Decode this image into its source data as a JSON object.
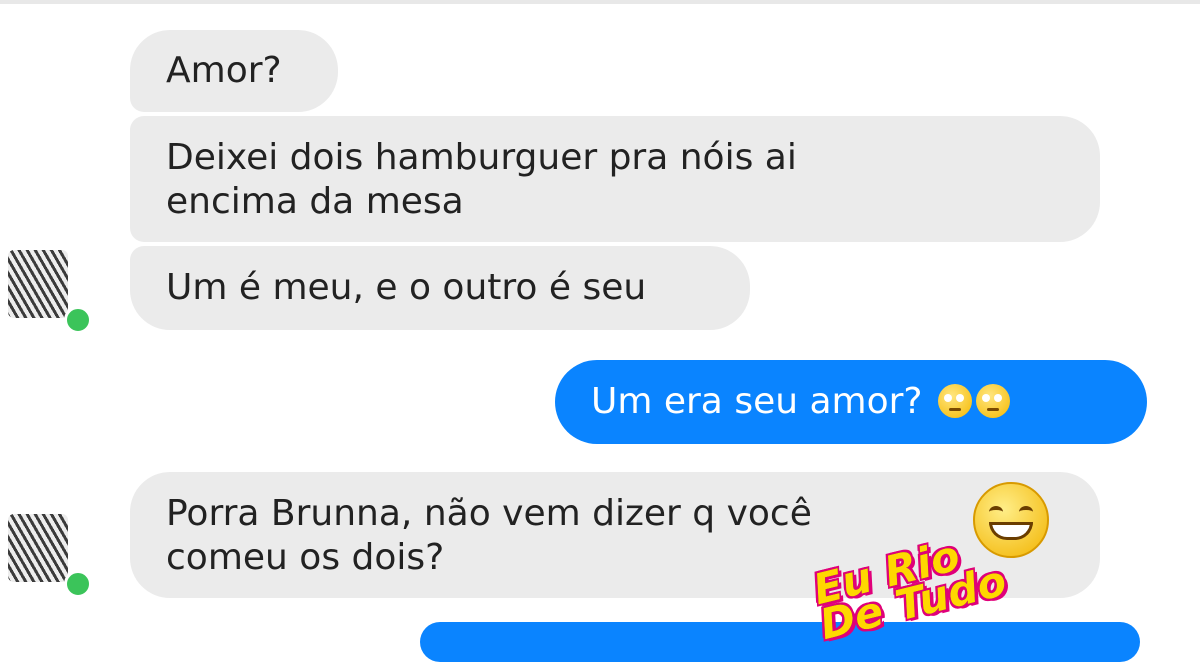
{
  "messages": [
    {
      "direction": "incoming",
      "lines": [
        "Amor?"
      ]
    },
    {
      "direction": "incoming",
      "lines": [
        "Deixei dois hamburguer pra nóis ai",
        "encima da mesa"
      ]
    },
    {
      "direction": "incoming",
      "lines": [
        "Um é meu, e o outro é seu"
      ]
    },
    {
      "direction": "outgoing",
      "lines": [
        "Um era seu amor?"
      ],
      "emoji": [
        "face-with-rolling-eyes",
        "face-with-rolling-eyes"
      ]
    },
    {
      "direction": "incoming",
      "lines": [
        "Porra Brunna, não vem dizer q você",
        "comeu os dois?"
      ]
    }
  ],
  "contact": {
    "status": "online"
  },
  "watermark": {
    "line1": "Eu Rio",
    "line2": "De Tudo",
    "icon": "grinning-face"
  },
  "colors": {
    "incoming_bubble": "#ebebeb",
    "outgoing_bubble": "#0a84ff",
    "online_dot": "#3bc45a"
  }
}
